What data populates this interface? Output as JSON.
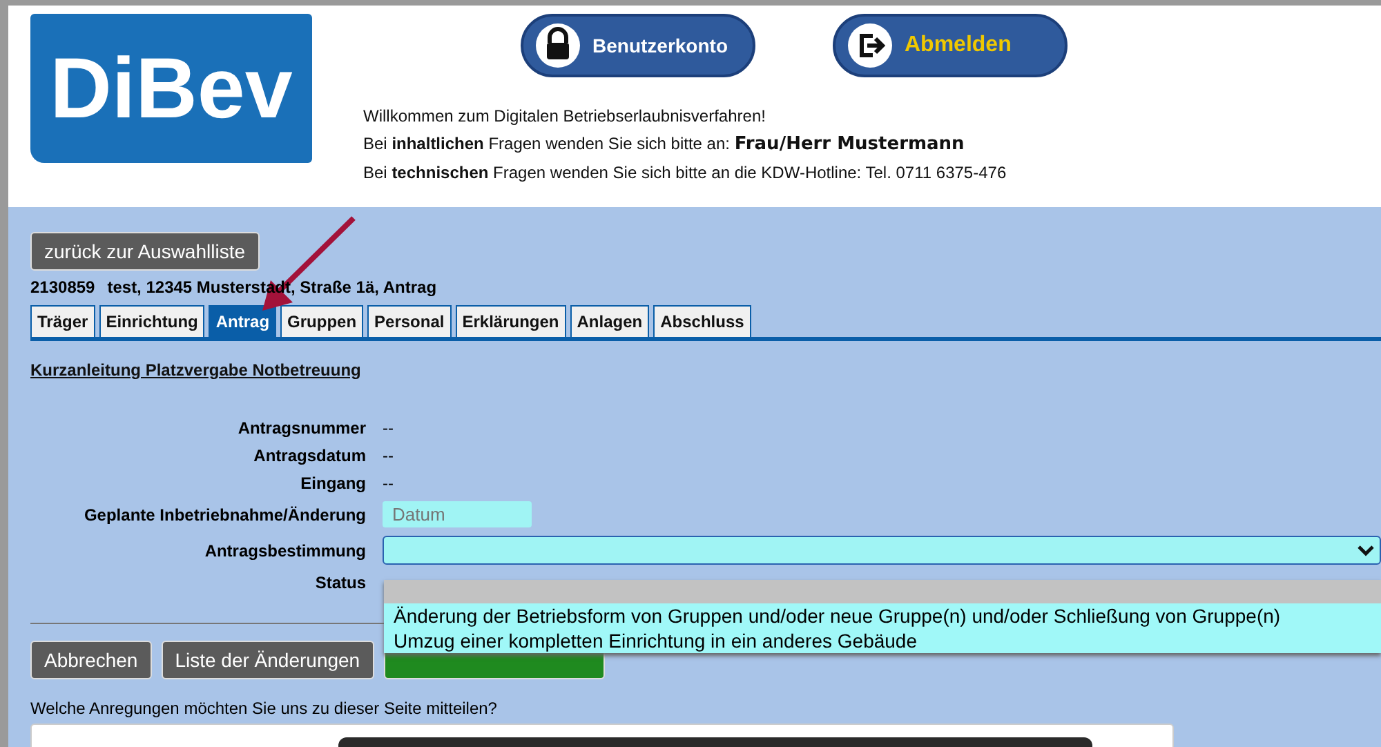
{
  "header": {
    "logo": "DiBev",
    "account_button": "Benutzerkonto",
    "logout_button": "Abmelden",
    "welcome": "Willkommen zum Digitalen Betriebserlaubnisverfahren!",
    "contact_line": "Bei **inhaltlichen** Fragen wenden Sie sich bitte an: ",
    "contact_name": "Frau/Herr Mustermann",
    "hotline_line": "Bei **technischen** Fragen wenden Sie sich bitte an die KDW-Hotline: Tel. 0711 6375-476"
  },
  "back_button": "zurück zur Auswahlliste",
  "record_id": "2130859",
  "record_title": "test, 12345 Musterstadt,  Straße 1ä, Antrag",
  "tabs": [
    {
      "label": "Träger",
      "selected": false
    },
    {
      "label": "Einrichtung",
      "selected": false
    },
    {
      "label": "Antrag",
      "selected": true
    },
    {
      "label": "Gruppen",
      "selected": false
    },
    {
      "label": "Personal",
      "selected": false
    },
    {
      "label": "Erklärungen",
      "selected": false
    },
    {
      "label": "Anlagen",
      "selected": false
    },
    {
      "label": "Abschluss",
      "selected": false
    }
  ],
  "guide_link": "Kurzanleitung Platzvergabe Notbetreuung",
  "fields": [
    {
      "label": "Antragsnummer",
      "kind": "text",
      "value": "--"
    },
    {
      "label": "Antragsdatum",
      "kind": "text",
      "value": "--"
    },
    {
      "label": "Eingang",
      "kind": "text",
      "value": "--"
    },
    {
      "label": "Geplante Inbetriebnahme/Änderung",
      "kind": "date",
      "placeholder": "Datum"
    },
    {
      "label": "Antragsbestimmung",
      "kind": "select"
    },
    {
      "label": "Status",
      "kind": "empty"
    }
  ],
  "dropdown": {
    "open": true,
    "options": [
      {
        "label": "Änderung der Betriebsform von Gruppen und/oder neue Gruppe(n) und/oder Schließung von Gruppe(n)",
        "selected": false
      },
      {
        "label": "Umzug einer kompletten Einrichtung in ein anderes Gebäude",
        "selected": false
      }
    ]
  },
  "buttons": [
    {
      "label": "Abbrechen",
      "kind": "grey"
    },
    {
      "label": "Liste der Änderungen",
      "kind": "grey"
    },
    {
      "kind": "green"
    }
  ],
  "feedback_question": "Welche Anregungen möchten Sie uns zu dieser Seite mitteilen?"
}
